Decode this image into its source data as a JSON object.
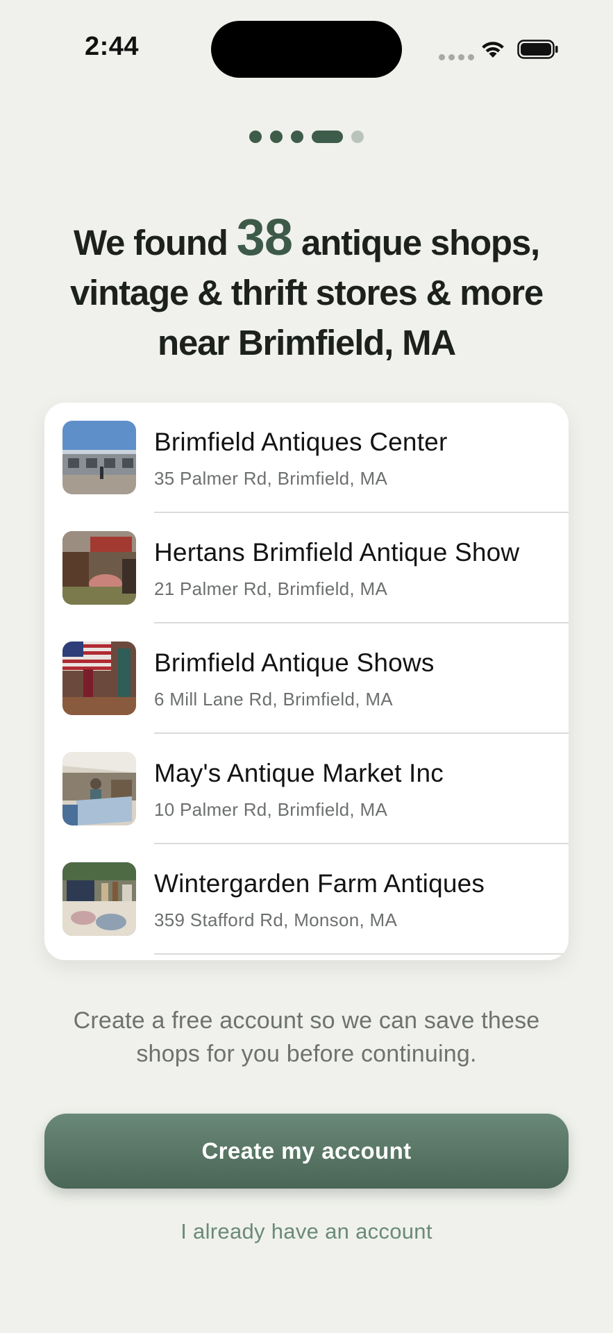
{
  "status_bar": {
    "time": "2:44"
  },
  "page_indicator": {
    "total": 5,
    "current": 4
  },
  "headline": {
    "prefix": "We found ",
    "count": "38",
    "line1_suffix": " antique shops,",
    "line2": "vintage & thrift stores & more",
    "line3": "near Brimfield, MA"
  },
  "shops": [
    {
      "name": "Brimfield Antiques Center",
      "address": "35 Palmer Rd, Brimfield, MA",
      "thumb_icon": "shop-photo"
    },
    {
      "name": "Hertans Brimfield Antique Show",
      "address": "21 Palmer Rd, Brimfield, MA",
      "thumb_icon": "shop-photo"
    },
    {
      "name": "Brimfield Antique Shows",
      "address": "6 Mill Lane Rd, Brimfield, MA",
      "thumb_icon": "shop-photo"
    },
    {
      "name": "May's Antique Market Inc",
      "address": "10 Palmer Rd, Brimfield, MA",
      "thumb_icon": "shop-photo"
    },
    {
      "name": "Wintergarden Farm Antiques",
      "address": "359 Stafford Rd, Monson, MA",
      "thumb_icon": "shop-photo"
    }
  ],
  "save_note": "Create a free account so we can save these shops for you before continuing.",
  "actions": {
    "primary_label": "Create my account",
    "secondary_label": "I already have an account"
  },
  "colors": {
    "background": "#f0f1ec",
    "accent": "#3e5c4a",
    "button": "#5a7866",
    "link": "#6a8a78"
  }
}
